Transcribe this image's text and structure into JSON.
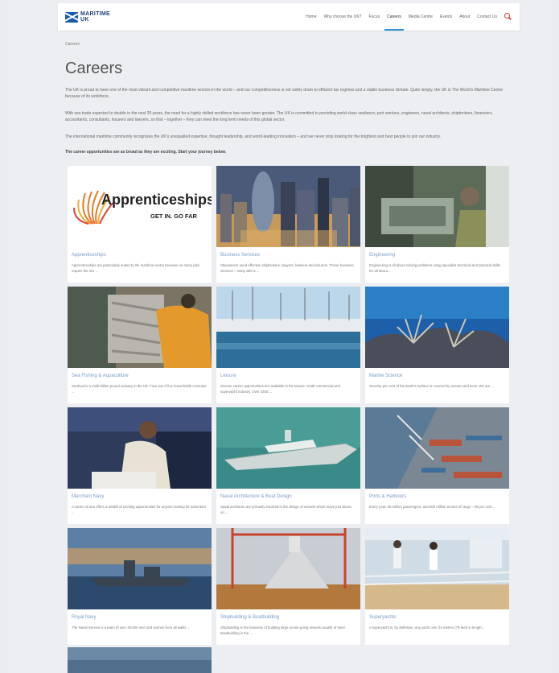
{
  "header": {
    "logo_line1": "MARITIME",
    "logo_line2": "UK",
    "nav": [
      "Home",
      "Why choose the UK?",
      "Focus",
      "Careers",
      "Media Centre",
      "Events",
      "About",
      "Contact Us"
    ],
    "active_nav": "Careers",
    "search_icon": "search-icon",
    "accent_color": "#2b8fd6",
    "search_color": "#d9433c"
  },
  "breadcrumb": "Careers",
  "page": {
    "title": "Careers",
    "intro": [
      "The UK is proud to have one of the most vibrant and competitive maritime sectors in the world – and our competitiveness is not solely down to efficient tax regimes and a stable business climate. Quite simply, the UK is The World's Maritime Centre because of its workforce.",
      "With sea trade expected to double in the next 20 years, the need for a highly skilled workforce has never been greater. The UK is committed to providing world-class seafarers, port workers, engineers, naval architects, shipbrokers, financiers, accountants, consultants, insurers and lawyers, so that – together – they can meet the long term needs of this global sector.",
      "The international maritime community recognises the UK's unequalled expertise, thought leadership, and world-leading innovation – and we never stop looking for the brightest and best people to join our industry."
    ],
    "lead": "The career opportunities are as broad as they are exciting. Start your journey below."
  },
  "cards": [
    {
      "title": "Apprenticeships",
      "desc": "Apprenticeships are particularly suited to the maritime sector because so many jobs require the mix ...",
      "logo_text": "Apprenticeships",
      "logo_tagline": "GET IN. GO FAR"
    },
    {
      "title": "Business Services",
      "desc": "Shipowners need effective shipbrokers, lawyers, bankers and insurers. These business services – many with a ..."
    },
    {
      "title": "Engineering",
      "desc": "Engineering is all about solving problems using specialist technical and practical skills. It's all about ..."
    },
    {
      "title": "Sea Fishing & Aquaculture",
      "desc": "Seafood is a multi-billion pound industry in the UK. Four out of five households consume ..."
    },
    {
      "title": "Leisure",
      "desc": "Diverse career opportunities are available in the leisure, small commercial and superyacht industry. Over 4400 ..."
    },
    {
      "title": "Marine Science",
      "desc": "Seventy per cent of the Earth's surface is covered by oceans and seas. We are ..."
    },
    {
      "title": "Merchant Navy",
      "desc": "A career at sea offers a wealth of exciting opportunities for anyone looking for adventure ..."
    },
    {
      "title": "Naval Architecture & Boat Design",
      "desc": "Naval architects are primarily involved in the design of vessels which move just above, on ..."
    },
    {
      "title": "Ports & Harbours",
      "desc": "Every year, 65 million passengers, and 500 million tonnes of cargo – 95 per cent ..."
    },
    {
      "title": "Royal Navy",
      "desc": "The Naval Service is a team of over 30,000 men and women from all walks ..."
    },
    {
      "title": "Shipbuilding & Boatbuilding",
      "desc": "Shipbuilding is the business of building large ocean-going vessels usually of steel. Boatbuilding is the ..."
    },
    {
      "title": "Superyachts",
      "desc": "A superyacht is, by definition, any yacht over 24 metres (79 feet) in length ..."
    }
  ]
}
